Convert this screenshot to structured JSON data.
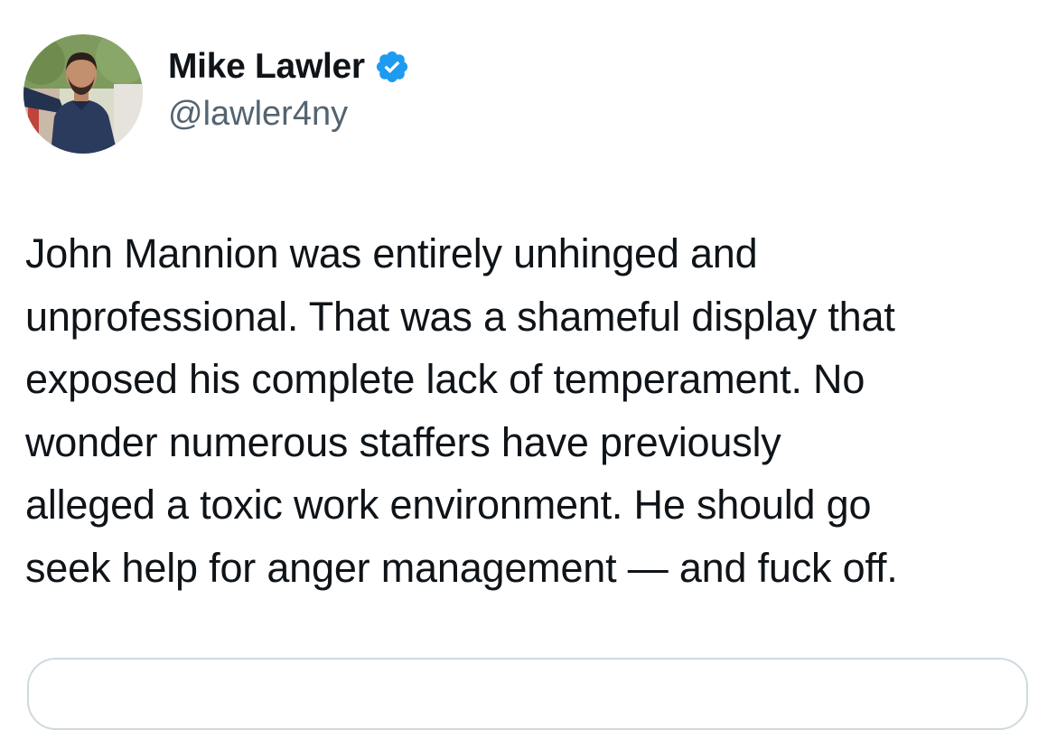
{
  "tweet": {
    "author": {
      "display_name": "Mike Lawler",
      "handle": "@lawler4ny",
      "verified_icon": "verified-badge-icon",
      "verified_color": "#1d9bf0"
    },
    "text_lines": [
      "John Mannion was entirely unhinged and",
      "unprofessional. That was a shameful display that",
      "exposed his complete lack of temperament. No",
      "wonder numerous staffers have previously",
      "alleged a toxic work environment. He should go",
      "seek help for anger management — and fuck off."
    ]
  },
  "colors": {
    "text_primary": "#0f1419",
    "text_secondary": "#536471",
    "border": "#cfd9de"
  }
}
